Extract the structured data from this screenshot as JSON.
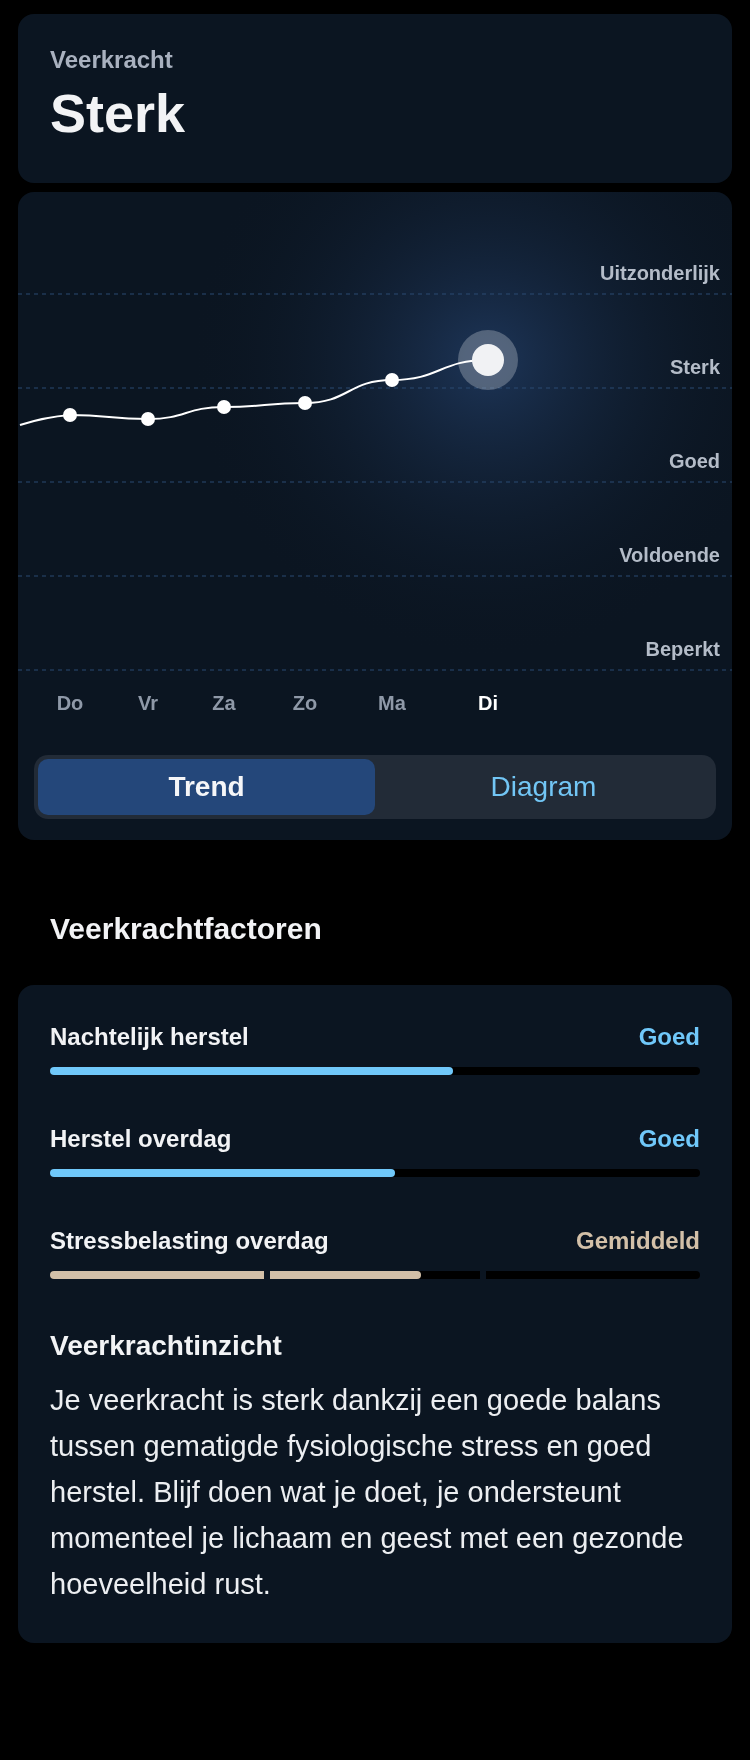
{
  "header": {
    "label": "Veerkracht",
    "value": "Sterk"
  },
  "chart": {
    "level_labels": [
      "Uitzonderlijk",
      "Sterk",
      "Goed",
      "Voldoende",
      "Beperkt"
    ],
    "days": [
      {
        "label": "Do",
        "selected": false
      },
      {
        "label": "Vr",
        "selected": false
      },
      {
        "label": "Za",
        "selected": false
      },
      {
        "label": "Zo",
        "selected": false
      },
      {
        "label": "Ma",
        "selected": false
      },
      {
        "label": "Di",
        "selected": true
      }
    ]
  },
  "view_toggle": [
    {
      "label": "Trend",
      "selected": true
    },
    {
      "label": "Diagram",
      "selected": false
    }
  ],
  "factors_title": "Veerkrachtfactoren",
  "factors": [
    {
      "kind": "continuous",
      "name": "Nachtelijk herstel",
      "rating": "Goed",
      "color": "#70c8fa",
      "level": 0.62
    },
    {
      "kind": "continuous",
      "name": "Herstel overdag",
      "rating": "Goed",
      "color": "#70c8fa",
      "level": 0.53
    },
    {
      "kind": "segmented",
      "name": "Stressbelasting overdag",
      "rating": "Gemiddeld",
      "color": "#d3c0a8",
      "level": 0.57
    }
  ],
  "insight": {
    "title": "Veerkrachtinzicht",
    "text": "Je veerkracht is sterk dankzij een goede balans tussen gematigde fysiologische stress en goed herstel. Blijf doen wat je doet, je ondersteunt momenteel je lichaam en geest met een gezonde hoeveelheid rust."
  }
}
